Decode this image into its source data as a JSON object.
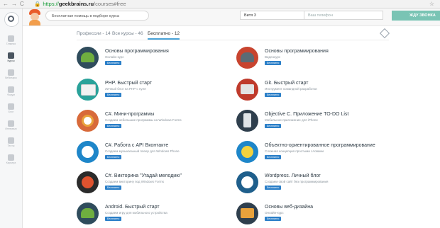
{
  "browser": {
    "back": "←",
    "forward": "→",
    "reload": "C",
    "protocol": "https://",
    "host": "geekbrains.ru",
    "path": "/courses#free",
    "bookmark": "☆"
  },
  "sidebar": {
    "items": [
      {
        "label": "Главная"
      },
      {
        "label": "Курсы"
      },
      {
        "label": "Вебинары"
      },
      {
        "label": "Форум"
      },
      {
        "label": "Блог"
      },
      {
        "label": "Интервью"
      },
      {
        "label": "Тесты"
      },
      {
        "label": "Карьера"
      }
    ]
  },
  "header": {
    "help_text": "Бесплатная помощь в подборе курса",
    "name_value": "Витя 3",
    "phone_placeholder": "Ваш телефон",
    "call_button": "ЖДУ ЗВОНКА"
  },
  "tabs": [
    {
      "label": "Профессии - 14"
    },
    {
      "label": "Все курсы - 46"
    },
    {
      "label": "Бесплатно - 12"
    }
  ],
  "courses": [
    {
      "title": "Основы программирования",
      "subtitle": "Онлайн-курс",
      "badge": "Бесплатно",
      "icon": "android-icon",
      "color": "#2f4c5c"
    },
    {
      "title": "Основы программирования",
      "subtitle": "Видеокурс",
      "badge": "Бесплатно",
      "icon": "android-icon",
      "color": "#c8442f"
    },
    {
      "title": "PHP. Быстрый старт",
      "subtitle": "Личный блог на PHP с нуля",
      "badge": "Бесплатно",
      "icon": "browser-icon",
      "color": "#2aa29a"
    },
    {
      "title": "Git. Быстрый старт",
      "subtitle": "Инструмент командной разработки",
      "badge": "Бесплатно",
      "icon": "git-icon",
      "color": "#bf3a2b"
    },
    {
      "title": "C#. Мини-программы",
      "subtitle": "Создаем небольшие программы на Windows Forms",
      "badge": "Бесплатно",
      "icon": "target-icon",
      "color": "#d86a3a"
    },
    {
      "title": "Objective C. Приложение TO-DO List",
      "subtitle": "Мобильное приложение для iPhone",
      "badge": "Бесплатно",
      "icon": "phone-icon",
      "color": "#2f3f4d"
    },
    {
      "title": "C#. Работа с API Вконтакте",
      "subtitle": "Создаем музыкальный плеер для Windows Phone",
      "badge": "Бесплатно",
      "icon": "vk-icon",
      "color": "#1e86c9"
    },
    {
      "title": "Объектно-ориентированное программирование",
      "subtitle": "Сложная концепция простыми словами",
      "badge": "Бесплатно",
      "icon": "oop-icon",
      "color": "#1e86c9"
    },
    {
      "title": "C#. Викторина \"Угадай мелодию\"",
      "subtitle": "Создаем викторину под Windows Forms",
      "badge": "Бесплатно",
      "icon": "music-icon",
      "color": "#2b2b2b"
    },
    {
      "title": "Wordpress. Личный блог",
      "subtitle": "Создаем свой сайт без программирования",
      "badge": "Бесплатно",
      "icon": "wordpress-icon",
      "color": "#1f5f8c"
    },
    {
      "title": "Android. Быстрый старт",
      "subtitle": "Создаем игру для мобильного устройства",
      "badge": "Бесплатно",
      "icon": "android-icon",
      "color": "#2f4c5c"
    },
    {
      "title": "Основы веб-дизайна",
      "subtitle": "Онлайн-курс",
      "badge": "Бесплатно",
      "icon": "webdesign-icon",
      "color": "#2f3f4d"
    }
  ]
}
